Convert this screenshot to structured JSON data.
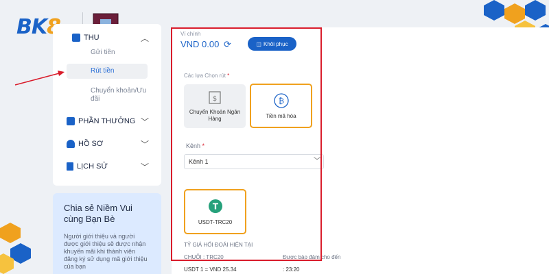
{
  "brand": {
    "logo_prefix": "BK",
    "logo_eight": "8"
  },
  "sidebar": {
    "section_withdraw": "THU",
    "sub_items": [
      "Gửi tiền",
      "Rút tiền",
      "Chuyển khoản/Ưu đãi"
    ],
    "items": [
      "PHẦN THƯỞNG",
      "HỒ SƠ",
      "LỊCH SỬ"
    ]
  },
  "promo": {
    "title": "Chia sẻ Niềm Vui cùng Bạn Bè",
    "body": "Người giới thiệu và người được giới thiệu sẽ được nhận khuyến mãi khi thành viên đăng ký sử dụng mã giới thiệu của bạn"
  },
  "wallet": {
    "label": "Ví chính",
    "balance": "VND 0.00",
    "restore_label": "Khôi phục"
  },
  "withdraw": {
    "options_label": "Các lựa Chọn rút",
    "option_bank": "Chuyển Khoản Ngân Hàng",
    "option_crypto": "Tiền mã hóa",
    "channel_label": "Kênh",
    "channel_value": "Kênh 1",
    "token_label": "USDT-TRC20",
    "rate_title": "TỶ GIÁ HỐI ĐOÁI HIỆN TẠI",
    "chain_label": "CHUỖI : TRC20",
    "guarantee_label": "Được bảo đảm cho đến",
    "rate_value": "USDT 1 = VND 25.34",
    "guarantee_time": ": 23:20"
  },
  "colors": {
    "brand_blue": "#1a62c7",
    "accent_orange": "#f0a11e",
    "highlight_red": "#d91c2b"
  }
}
